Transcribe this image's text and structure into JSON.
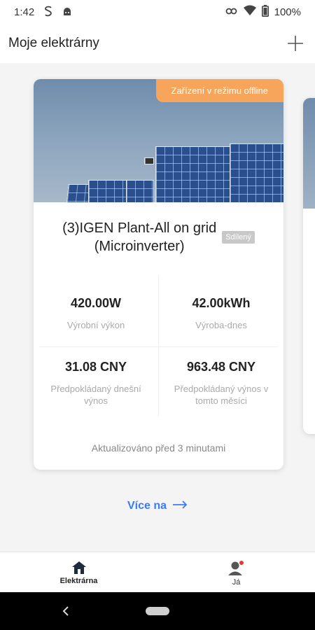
{
  "status_bar": {
    "time": "1:42",
    "battery": "100%"
  },
  "header": {
    "title": "Moje elektrárny"
  },
  "plant_card": {
    "offline_badge": "Zařízení v režimu offline",
    "name_line1": "(3)IGEN Plant-All on grid",
    "name_line2": "(Microinverter)",
    "shared_badge": "Sdílený",
    "metrics": [
      {
        "value": "420.00W",
        "label": "Výrobní výkon"
      },
      {
        "value": "42.00kWh",
        "label": "Výroba-dnes"
      },
      {
        "value": "31.08 CNY",
        "label": "Předpokládaný dnešní výnos"
      },
      {
        "value": "963.48 CNY",
        "label": "Předpokládaný výnos v tomto měsíci"
      }
    ],
    "updated": "Aktualizováno před 3 minutami"
  },
  "more_link": {
    "label": "Více na",
    "arrow": "⟶"
  },
  "bottom_nav": {
    "items": [
      {
        "label": "Elektrárna",
        "icon": "home-icon",
        "active": true
      },
      {
        "label": "Já",
        "icon": "profile-icon",
        "active": false
      }
    ]
  },
  "colors": {
    "accent": "#3a7bf5",
    "offline": "#f7a55b",
    "notification": "#e53935"
  }
}
